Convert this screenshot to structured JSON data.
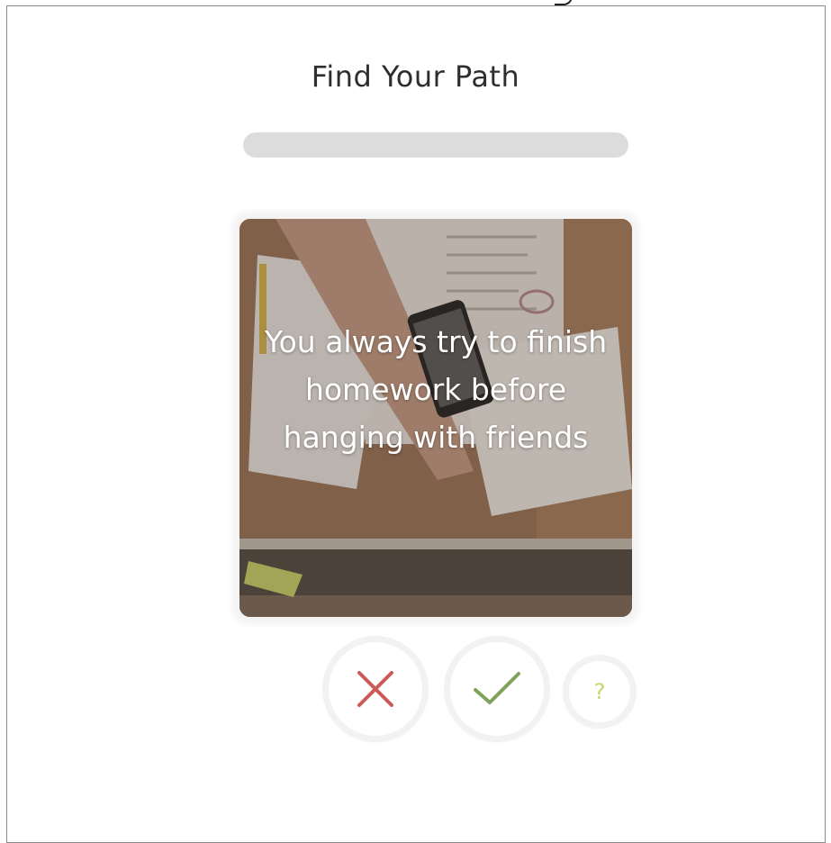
{
  "header": {
    "title": "Find Your Path"
  },
  "progress": {
    "value": 0
  },
  "card": {
    "statement": "You always try to finish homework before hanging with friends",
    "image_icon": "desk-homework-photo"
  },
  "actions": {
    "disagree_icon": "close-icon",
    "agree_icon": "check-icon",
    "unsure_label": "?"
  },
  "colors": {
    "disagree": "#cc5a5a",
    "agree": "#7fa35a",
    "unsure": "#c8d46a",
    "progress_track": "#dcdcdc",
    "title": "#2e2e2e"
  }
}
